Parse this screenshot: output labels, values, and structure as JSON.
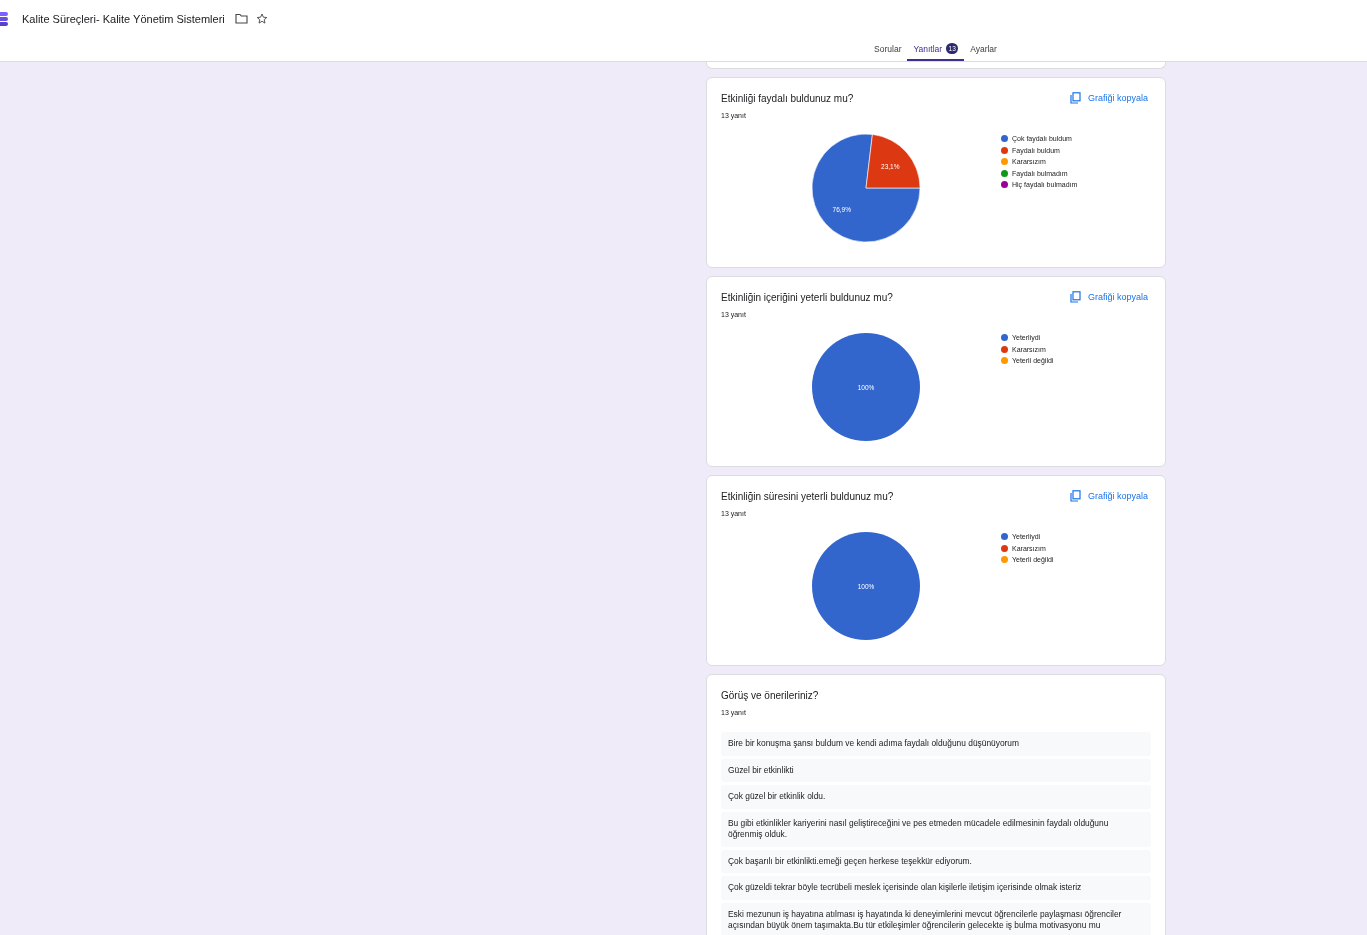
{
  "header": {
    "title": "Kalite Süreçleri- Kalite Yönetim Sistemleri"
  },
  "tabs": [
    {
      "label": "Sorular",
      "selected": false
    },
    {
      "label": "Yanıtlar",
      "selected": true,
      "badge": "13"
    },
    {
      "label": "Ayarlar",
      "selected": false
    }
  ],
  "questions": [
    {
      "kind": "pie",
      "title": "Etkinliği faydalı buldunuz mu?",
      "count": "13 yanıt",
      "copy_label": "Grafiği kopyala",
      "legend": [
        {
          "color": "#3366cc"
        },
        {
          "color": "#dc3912"
        },
        {
          "color": "#ff9900"
        },
        {
          "color": "#109618"
        },
        {
          "color": "#990099"
        }
      ],
      "chart_data": {
        "type": "pie",
        "categories": [
          "Çok faydalı buldum",
          "Faydalı buldum",
          "Kararsızım",
          "Faydalı bulmadım",
          "Hiç faydalı bulmadım"
        ],
        "values": [
          76.9,
          23.1,
          0,
          0,
          0
        ],
        "value_labels": [
          "76,9%",
          "23,1%",
          null,
          null,
          null
        ]
      }
    },
    {
      "kind": "pie",
      "title": "Etkinliğin içeriğini yeterli buldunuz mu?",
      "count": "13 yanıt",
      "copy_label": "Grafiği kopyala",
      "legend": [
        {
          "color": "#3366cc"
        },
        {
          "color": "#dc3912"
        },
        {
          "color": "#ff9900"
        }
      ],
      "chart_data": {
        "type": "pie",
        "categories": [
          "Yeterliydi",
          "Kararsızım",
          "Yeterli değildi"
        ],
        "values": [
          100,
          0,
          0
        ],
        "value_labels": [
          "100%",
          null,
          null
        ]
      }
    },
    {
      "kind": "pie",
      "title": "Etkinliğin süresini yeterli buldunuz mu?",
      "count": "13 yanıt",
      "copy_label": "Grafiği kopyala",
      "legend": [
        {
          "color": "#3366cc"
        },
        {
          "color": "#dc3912"
        },
        {
          "color": "#ff9900"
        }
      ],
      "chart_data": {
        "type": "pie",
        "categories": [
          "Yeterliydi",
          "Kararsızım",
          "Yeterli değildi"
        ],
        "values": [
          100,
          0,
          0
        ],
        "value_labels": [
          "100%",
          null,
          null
        ]
      }
    },
    {
      "kind": "text",
      "title": "Görüş ve önerileriniz?",
      "count": "13 yanıt",
      "responses": [
        "Bire bir konuşma şansı buldum ve kendi adıma faydalı olduğunu düşünüyorum",
        "Güzel bir etkinlikti",
        "Çok güzel bir etkinlik oldu.",
        "Bu gibi etkinlikler kariyerini nasıl geliştireceğini ve pes etmeden mücadele edilmesinin faydalı olduğunu öğrenmiş olduk.",
        "Çok başarılı bir etkinlikti.emeği geçen herkese teşekkür ediyorum.",
        "Çok güzeldi tekrar böyle tecrübeli meslek içerisinde olan kişilerle iletişim içerisinde olmak isteriz",
        "Eski mezunun iş hayatına atılması iş hayatında ki deneyimlerini mevcut öğrencilerle paylaşması öğrenciler açısından büyük önem taşımakta.Bu tür etkileşimler öğrencilerin gelecekte iş bulma motivasyonu mu"
      ]
    }
  ]
}
